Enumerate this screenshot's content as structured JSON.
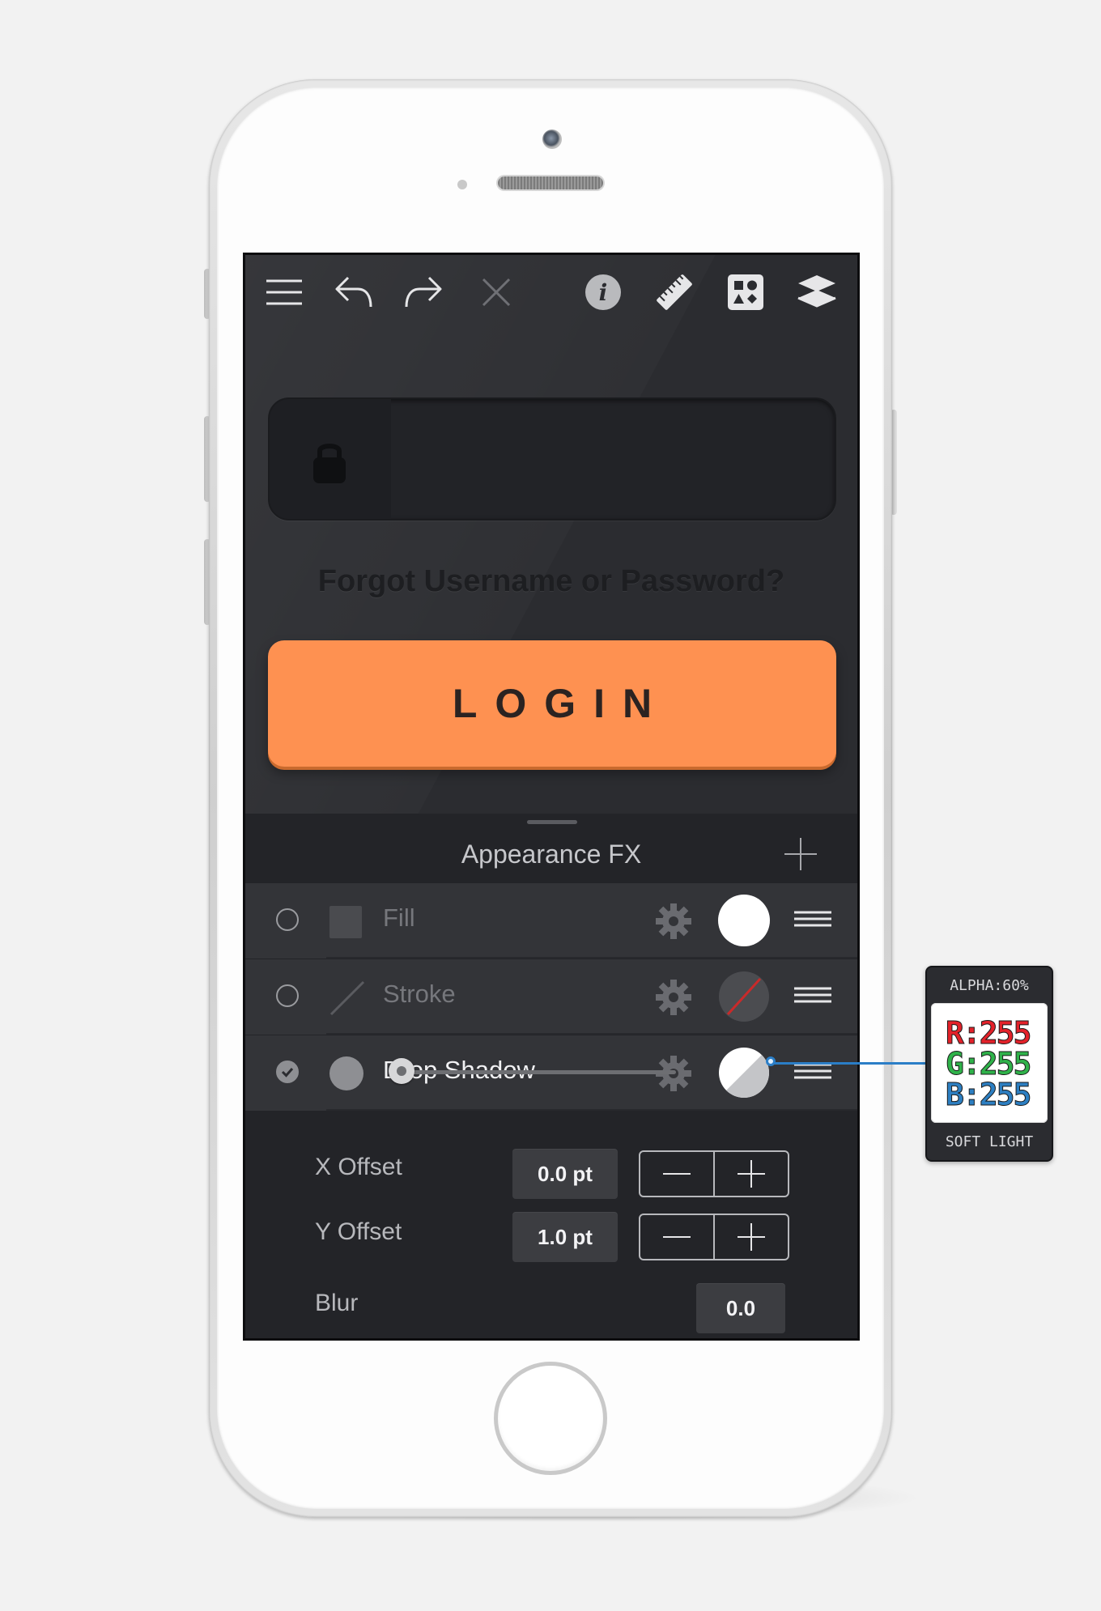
{
  "toolbar": {
    "icons": [
      "menu-icon",
      "undo-icon",
      "redo-icon",
      "close-icon",
      "info-icon",
      "ruler-icon",
      "shapes-icon",
      "layers-icon"
    ]
  },
  "login_form": {
    "password_placeholder": "",
    "forgot_link": "Forgot Username or Password?",
    "login_button": "LOGIN",
    "login_color": "#fe9151"
  },
  "panel": {
    "title": "Appearance FX",
    "effects": [
      {
        "label": "Fill",
        "checked": false,
        "swatch": "#ffffff"
      },
      {
        "label": "Stroke",
        "checked": false,
        "swatch": "none"
      },
      {
        "label": "Drop Shadow",
        "checked": true,
        "swatch": "#ffffff"
      }
    ],
    "properties": {
      "x_offset": {
        "label": "X Offset",
        "value": "0.0 pt"
      },
      "y_offset": {
        "label": "Y Offset",
        "value": "1.0 pt"
      },
      "blur": {
        "label": "Blur",
        "value": "0.0",
        "level": 0
      }
    }
  },
  "color_card": {
    "alpha": "ALPHA:60%",
    "r": "R:255",
    "g": "G:255",
    "b": "B:255",
    "blend_mode": "SOFT LIGHT",
    "colors": {
      "r": "#e3222a",
      "g": "#2fb24a",
      "b": "#2d7fc2"
    }
  }
}
